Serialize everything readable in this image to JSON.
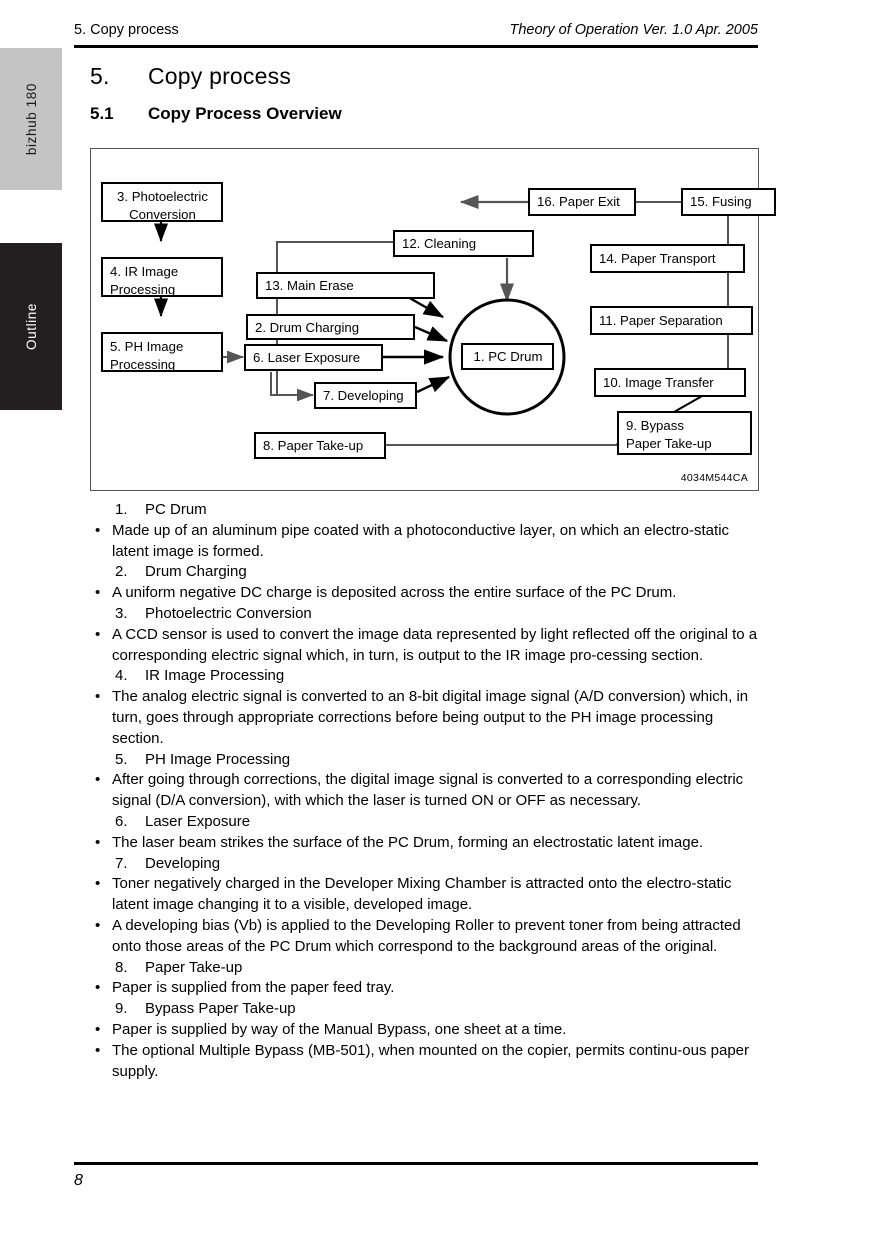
{
  "sidebar": {
    "tabs": [
      {
        "label": "bizhub 180",
        "style": "light"
      },
      {
        "label": "Outline",
        "style": "dark"
      }
    ]
  },
  "header": {
    "left": "5. Copy process",
    "right": "Theory of Operation Ver. 1.0 Apr. 2005"
  },
  "headings": {
    "chapter_number": "5.",
    "chapter_title": "Copy process",
    "section_number": "5.1",
    "section_title": "Copy Process Overview"
  },
  "figure": {
    "id": "4034M544CA",
    "boxes": {
      "photoelectric": "3. Photoelectric\nConversion",
      "ir_image": "4. IR Image\nProcessing",
      "ph_image": "5. PH Image\nProcessing",
      "laser_exposure": "6. Laser Exposure",
      "developing": "7. Developing",
      "drum_charging": "2. Drum Charging",
      "main_erase": "13. Main Erase",
      "cleaning": "12. Cleaning",
      "paper_exit": "16. Paper Exit",
      "fusing": "15. Fusing",
      "paper_transport": "14. Paper Transport",
      "paper_separation": "11. Paper Separation",
      "image_transfer": "10. Image Transfer",
      "bypass_take_up": "9. Bypass\n    Paper Take-up",
      "paper_take_up": "8. Paper Take-up",
      "pc_drum": "1. PC Drum"
    }
  },
  "body": [
    {
      "type": "numbered",
      "n": "1.",
      "text": "PC Drum"
    },
    {
      "type": "bullet",
      "text": "Made up of an aluminum pipe coated with a photoconductive layer, on which an electro-static latent image is formed."
    },
    {
      "type": "numbered",
      "n": "2.",
      "text": "Drum Charging"
    },
    {
      "type": "bullet",
      "text": "A uniform negative DC charge is deposited across the entire surface of the PC Drum."
    },
    {
      "type": "numbered",
      "n": "3.",
      "text": "Photoelectric Conversion"
    },
    {
      "type": "bullet",
      "text": "A CCD sensor is used to convert the image data represented by light reflected off the original to a corresponding electric signal which, in turn, is output to the IR image pro-cessing section."
    },
    {
      "type": "numbered",
      "n": "4.",
      "text": "IR Image Processing"
    },
    {
      "type": "bullet",
      "text": "The analog electric signal is converted to an 8-bit digital image signal (A/D conversion) which, in turn, goes through appropriate corrections before being output to the PH image processing section."
    },
    {
      "type": "numbered",
      "n": "5.",
      "text": "PH Image Processing"
    },
    {
      "type": "bullet",
      "text": "After going through corrections, the digital image signal is converted to a corresponding electric signal (D/A conversion), with which the laser is turned ON or OFF as necessary."
    },
    {
      "type": "numbered",
      "n": "6.",
      "text": "Laser Exposure"
    },
    {
      "type": "bullet",
      "text": "The laser beam strikes the surface of the PC Drum, forming an electrostatic latent image."
    },
    {
      "type": "numbered",
      "n": "7.",
      "text": "Developing"
    },
    {
      "type": "bullet",
      "text": "Toner negatively charged in the Developer Mixing Chamber is attracted onto the electro-static latent image changing it to a visible, developed image."
    },
    {
      "type": "bullet",
      "text": "A developing bias (Vb) is applied to the Developing Roller to prevent toner from being attracted onto those areas of the PC Drum which correspond to the background areas of the original."
    },
    {
      "type": "numbered",
      "n": "8.",
      "text": "Paper Take-up"
    },
    {
      "type": "bullet",
      "text": "Paper is supplied from the paper feed tray."
    },
    {
      "type": "numbered",
      "n": "9.",
      "text": "Bypass Paper Take-up"
    },
    {
      "type": "bullet",
      "text": "Paper is supplied by way of the Manual Bypass, one sheet at a time."
    },
    {
      "type": "bullet",
      "text": "The optional Multiple Bypass (MB-501), when mounted on the copier, permits continu-ous paper supply."
    }
  ],
  "footer": {
    "page_number": "8"
  }
}
